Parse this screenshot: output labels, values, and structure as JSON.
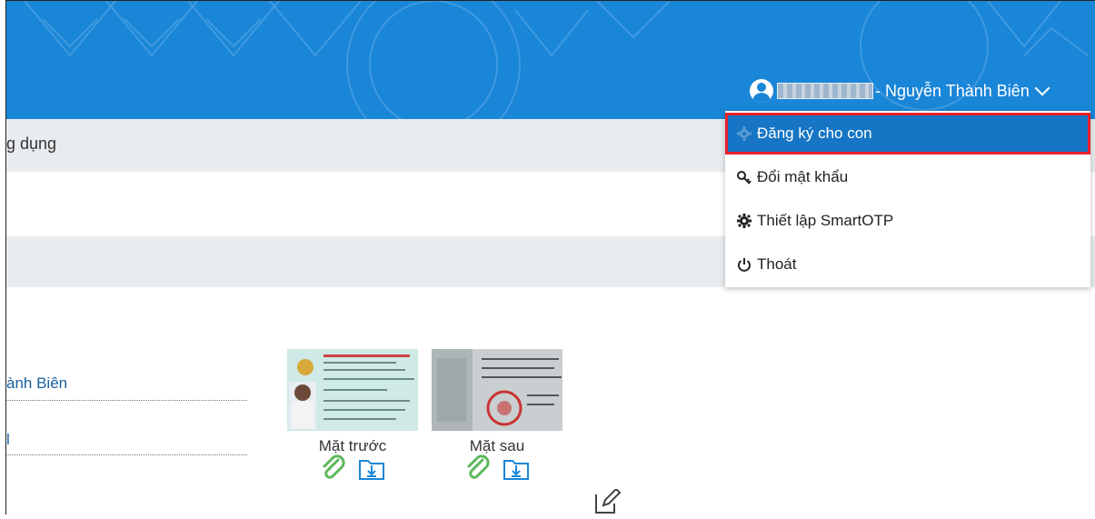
{
  "header": {
    "user_name": "- Nguyễn Thành Biên"
  },
  "dropdown": {
    "items": [
      {
        "label": "Đăng ký cho con",
        "icon": "gear-icon"
      },
      {
        "label": "Đổi mật khẩu",
        "icon": "key-icon"
      },
      {
        "label": "Thiết lập SmartOTP",
        "icon": "gear-icon"
      },
      {
        "label": "Thoát",
        "icon": "power-icon"
      }
    ]
  },
  "section": {
    "band_text": "g dụng"
  },
  "profile": {
    "name_value": "ành Biên",
    "second_value": "l"
  },
  "documents": {
    "front_caption": "Mặt trước",
    "back_caption": "Mặt sau"
  },
  "colors": {
    "header_bg": "#1a86d8",
    "active_item_bg": "#1675c4",
    "highlight_border": "#e8202a",
    "attach_icon": "#5cb85c",
    "download_icon": "#1a86d8"
  }
}
